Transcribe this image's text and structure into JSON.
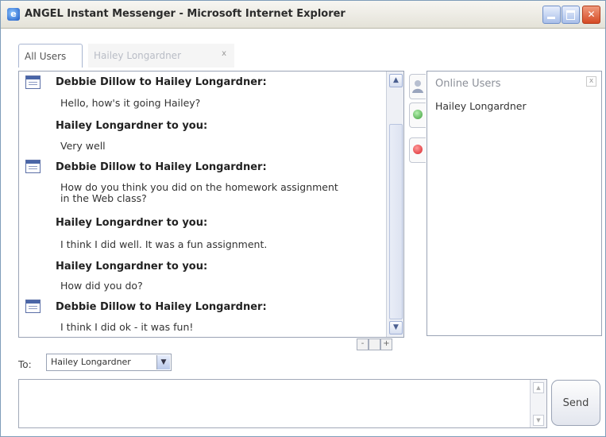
{
  "window": {
    "title": "ANGEL Instant Messenger - Microsoft Internet Explorer",
    "buttons": {
      "minimize": "",
      "maximize": "",
      "close": "✕"
    }
  },
  "tabs": [
    {
      "label": "All Users",
      "active": true
    },
    {
      "label": "Hailey Longardner",
      "active": false,
      "close_glyph": "x"
    }
  ],
  "messages": [
    {
      "sender": "Debbie Dillow to Hailey Longardner:",
      "text": "Hello, how's it going Hailey?",
      "has_icon": true
    },
    {
      "sender": "Hailey Longardner to you:",
      "text": "Very well",
      "has_icon": false
    },
    {
      "sender": "Debbie Dillow to Hailey Longardner:",
      "text": "How do you think you did on the homework assignment in the Web class?",
      "has_icon": true
    },
    {
      "sender": "Hailey Longardner to you:",
      "text": "I think I did well. It was a fun assignment.",
      "has_icon": false
    },
    {
      "sender": "Hailey Longardner to you:",
      "text": "How did you do?",
      "has_icon": false
    },
    {
      "sender": "Debbie Dillow to Hailey Longardner:",
      "text": "I think I did ok - it was fun!",
      "has_icon": true
    }
  ],
  "zoom": {
    "minus": "-",
    "reset": "",
    "plus": "+"
  },
  "users_panel": {
    "header": "Online Users",
    "close_glyph": "x",
    "users": [
      "Hailey Longardner"
    ]
  },
  "compose": {
    "to_label": "To:",
    "to_value": "Hailey Longardner",
    "message_value": "",
    "send_label": "Send"
  },
  "colors": {
    "titlebar_close": "#d54a24",
    "status_online": "#4caf50",
    "status_block": "#d9262b"
  }
}
